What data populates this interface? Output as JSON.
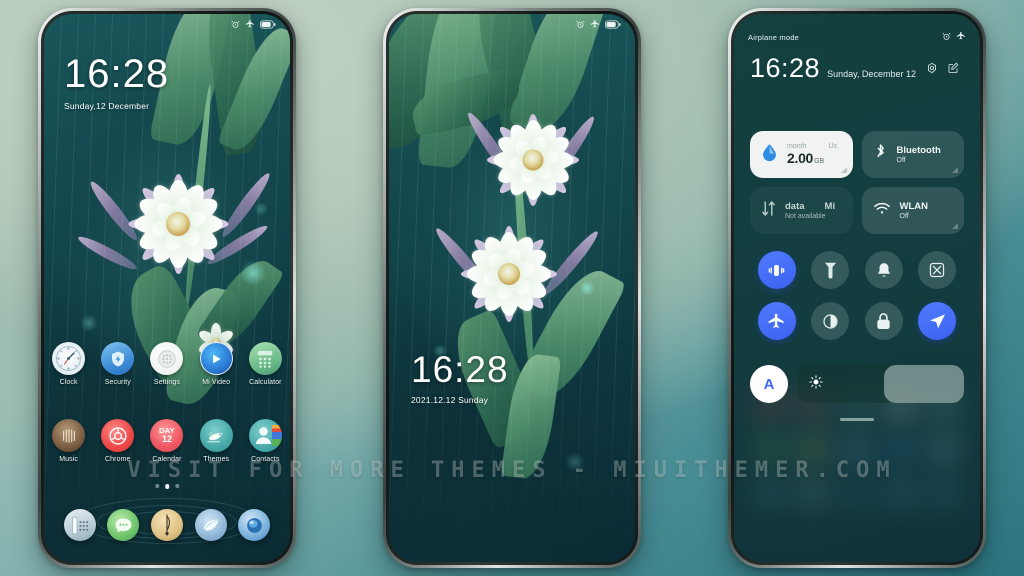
{
  "meta": {
    "watermark": "VISIT FOR MORE THEMES - MIUITHEMER.COM",
    "background_top": "#bdd0c2",
    "background_bottom": "#2b7480",
    "accent_blue": "#4f7bff"
  },
  "phone1": {
    "name": "home-screen",
    "statusbar": {
      "alarm_icon": "alarm-icon",
      "airplane_icon": "airplane-icon",
      "battery_icon": "battery-icon"
    },
    "clock": {
      "time": "16:28",
      "date": "Sunday,12 December"
    },
    "apps_row1": [
      {
        "label": "Clock",
        "icon": "clock-app-icon"
      },
      {
        "label": "Security",
        "icon": "security-shield-icon"
      },
      {
        "label": "Settings",
        "icon": "settings-gear-icon"
      },
      {
        "label": "Mi Video",
        "icon": "mi-video-play-icon"
      },
      {
        "label": "Calculator",
        "icon": "calculator-icon"
      }
    ],
    "apps_row2": [
      {
        "label": "Music",
        "icon": "music-icon"
      },
      {
        "label": "Chrome",
        "icon": "chrome-icon"
      },
      {
        "label": "Calendar",
        "icon": "calendar-icon",
        "day_label": "DAY",
        "day_number": "12"
      },
      {
        "label": "Themes",
        "icon": "themes-bird-icon"
      },
      {
        "label": "Contacts",
        "icon": "contacts-person-icon"
      }
    ],
    "page_dots": {
      "count": 3,
      "active_index": 1
    },
    "dock": [
      {
        "icon": "phone-dialer-icon"
      },
      {
        "icon": "messages-icon"
      },
      {
        "icon": "compass-browser-icon"
      },
      {
        "icon": "gallery-leaf-icon"
      },
      {
        "icon": "browser-globe-icon"
      }
    ]
  },
  "phone2": {
    "name": "lock-screen",
    "statusbar": {
      "alarm_icon": "alarm-icon",
      "airplane_icon": "airplane-icon",
      "battery_icon": "battery-icon"
    },
    "clock": {
      "time": "16:28",
      "date": "2021.12.12 Sunday"
    }
  },
  "phone3": {
    "name": "control-center",
    "statusbar_label": "Airplane mode",
    "statusbar": {
      "alarm_icon": "alarm-icon",
      "airplane_icon": "airplane-icon"
    },
    "clock": {
      "time": "16:28",
      "date": "Sunday, December 12"
    },
    "head_icons": [
      "settings-gear-icon",
      "edit-pencil-icon"
    ],
    "big_tiles": [
      {
        "title_top_left": "month",
        "title_top_right": "Us",
        "value": "2.00",
        "unit": "GB",
        "icon": "data-drop-icon",
        "style": "light"
      },
      {
        "title": "Bluetooth",
        "sub": "Off",
        "icon": "bluetooth-icon",
        "style": "dim"
      },
      {
        "title_top_left": "data",
        "title_top_right": "Mi",
        "sub": "Not available",
        "icon": "mobile-data-icon",
        "style": "ghost"
      },
      {
        "title": "WLAN",
        "sub": "Off",
        "icon": "wifi-icon",
        "style": "dim"
      }
    ],
    "toggles": [
      {
        "icon": "vibrate-icon",
        "state": "on"
      },
      {
        "icon": "flashlight-icon",
        "state": "off"
      },
      {
        "icon": "bell-ringtone-icon",
        "state": "off"
      },
      {
        "icon": "screenshot-icon",
        "state": "off"
      },
      {
        "icon": "airplane-icon",
        "state": "on"
      },
      {
        "icon": "dark-mode-icon",
        "state": "off"
      },
      {
        "icon": "lock-icon",
        "state": "off"
      },
      {
        "icon": "location-icon",
        "state": "on"
      }
    ],
    "brightness": {
      "auto_label": "A",
      "auto_icon": "auto-brightness-icon",
      "sun_icon": "brightness-sun-icon",
      "level_percent": 52
    }
  }
}
